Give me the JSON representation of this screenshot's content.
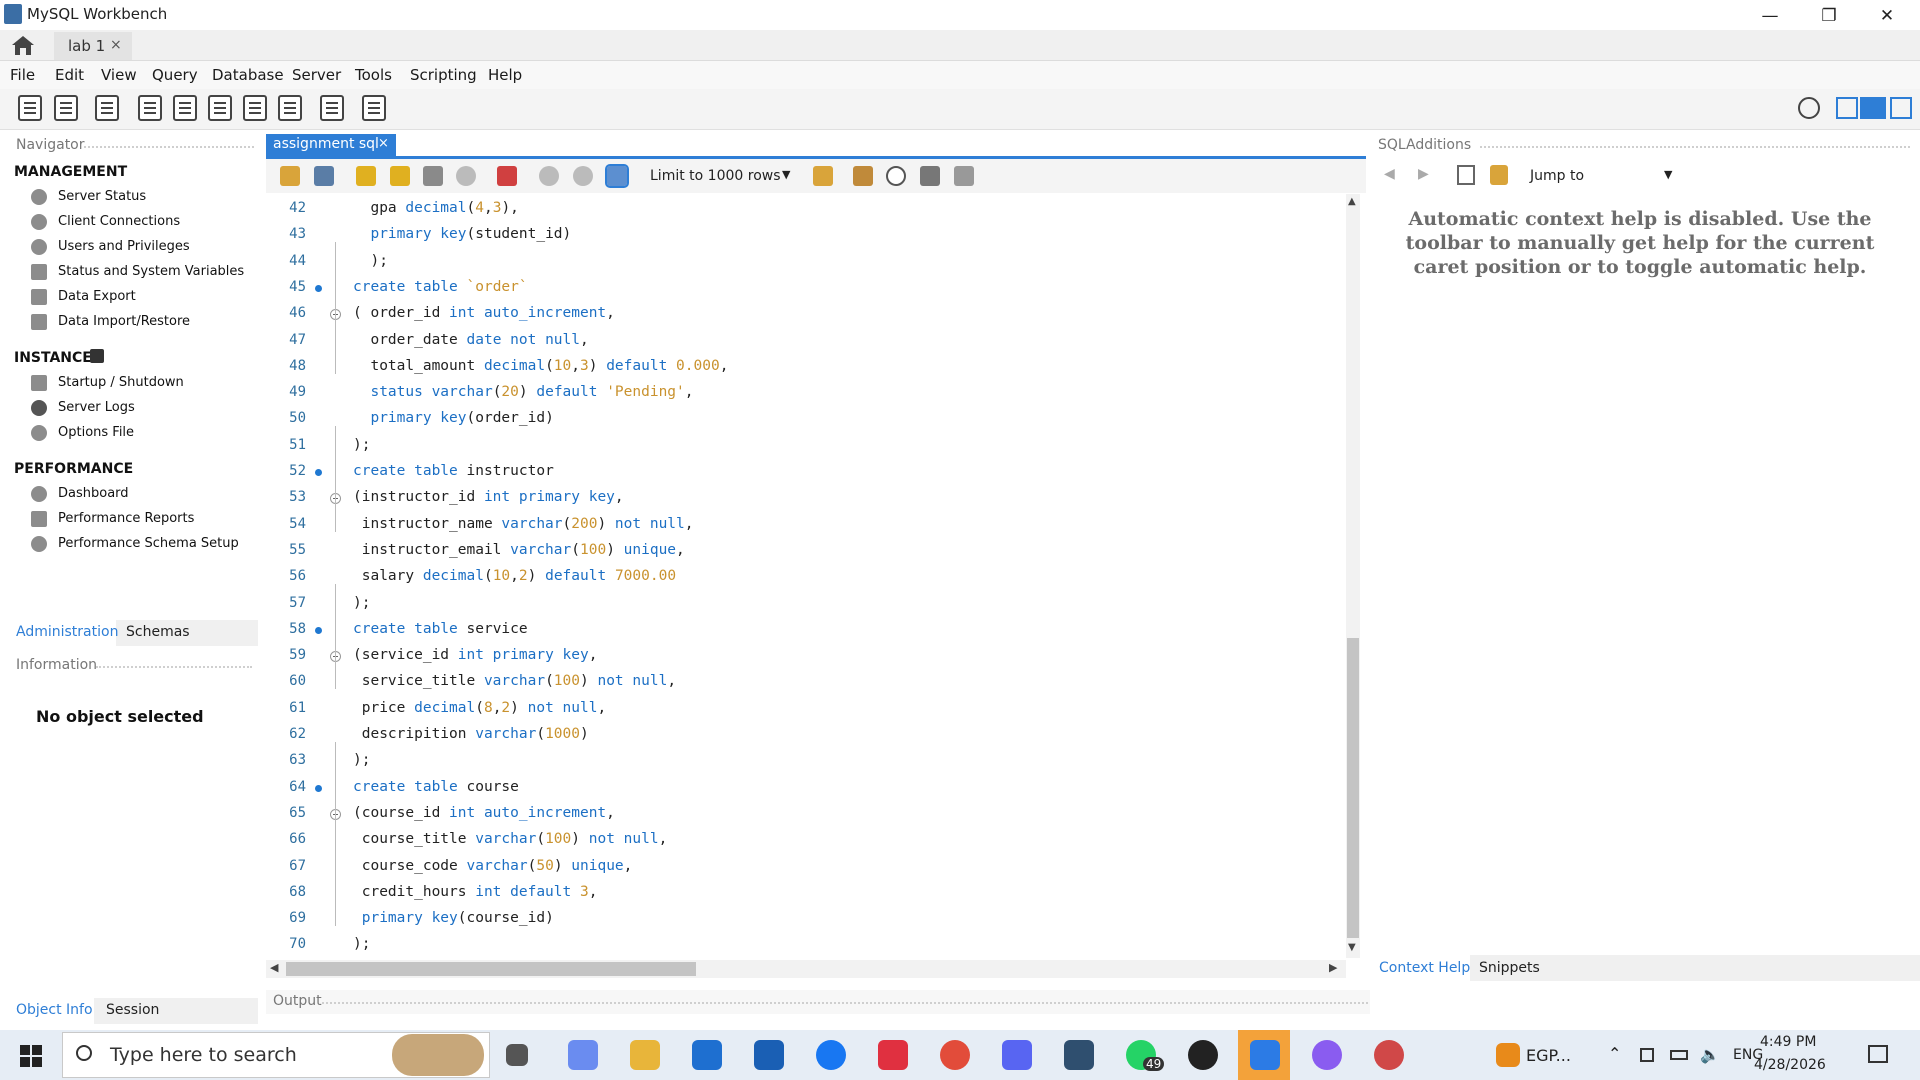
{
  "window": {
    "title": "MySQL Workbench",
    "minimize": "—",
    "maximize": "❐",
    "close": "✕"
  },
  "connection_tab": {
    "label": "lab 1",
    "close": "×"
  },
  "menu": [
    "File",
    "Edit",
    "View",
    "Query",
    "Database",
    "Server",
    "Tools",
    "Scripting",
    "Help"
  ],
  "navigator": {
    "title": "Navigator",
    "management": {
      "heading": "MANAGEMENT",
      "items": [
        "Server Status",
        "Client Connections",
        "Users and Privileges",
        "Status and System Variables",
        "Data Export",
        "Data Import/Restore"
      ]
    },
    "instance": {
      "heading": "INSTANCE",
      "items": [
        "Startup / Shutdown",
        "Server Logs",
        "Options File"
      ]
    },
    "performance": {
      "heading": "PERFORMANCE",
      "items": [
        "Dashboard",
        "Performance Reports",
        "Performance Schema Setup"
      ]
    },
    "tabs": [
      "Administration",
      "Schemas"
    ],
    "information": {
      "title": "Information",
      "message": "No object selected"
    },
    "bottom_tabs": [
      "Object Info",
      "Session"
    ]
  },
  "editor": {
    "tab_label": "assignment sql",
    "tab_close": "×",
    "limit_label": "Limit to 1000 rows",
    "lines": [
      {
        "n": "42",
        "code": [
          [
            "  gpa ",
            ""
          ],
          [
            "decimal",
            "t"
          ],
          [
            "(",
            ""
          ],
          [
            "4",
            "n"
          ],
          [
            ",",
            ""
          ],
          [
            "3",
            "n"
          ],
          [
            "),",
            ""
          ]
        ]
      },
      {
        "n": "43",
        "code": [
          [
            "  ",
            ""
          ],
          [
            "primary key",
            "k"
          ],
          [
            "(student_id)",
            ""
          ]
        ]
      },
      {
        "n": "44",
        "code": [
          [
            "  );",
            ""
          ]
        ]
      },
      {
        "n": "45",
        "code": [
          [
            "create table ",
            "k"
          ],
          [
            "`order`",
            "s"
          ]
        ]
      },
      {
        "n": "46",
        "code": [
          [
            "( order_id ",
            ""
          ],
          [
            "int auto_increment",
            "k"
          ],
          [
            ",",
            ""
          ]
        ]
      },
      {
        "n": "47",
        "code": [
          [
            "  order_date ",
            ""
          ],
          [
            "date not null",
            "k"
          ],
          [
            ",",
            ""
          ]
        ]
      },
      {
        "n": "48",
        "code": [
          [
            "  total_amount ",
            ""
          ],
          [
            "decimal",
            "t"
          ],
          [
            "(",
            ""
          ],
          [
            "10",
            "n"
          ],
          [
            ",",
            ""
          ],
          [
            "3",
            "n"
          ],
          [
            ") ",
            ""
          ],
          [
            "default ",
            "k"
          ],
          [
            "0.000",
            "n"
          ],
          [
            ",",
            ""
          ]
        ]
      },
      {
        "n": "49",
        "code": [
          [
            "  ",
            ""
          ],
          [
            "status varchar",
            "k"
          ],
          [
            "(",
            ""
          ],
          [
            "20",
            "n"
          ],
          [
            ") ",
            ""
          ],
          [
            "default ",
            "k"
          ],
          [
            "'Pending'",
            "s"
          ],
          [
            ",",
            ""
          ]
        ]
      },
      {
        "n": "50",
        "code": [
          [
            "  ",
            ""
          ],
          [
            "primary key",
            "k"
          ],
          [
            "(order_id)",
            ""
          ]
        ]
      },
      {
        "n": "51",
        "code": [
          [
            ");",
            ""
          ]
        ]
      },
      {
        "n": "52",
        "code": [
          [
            "create table ",
            "k"
          ],
          [
            "instructor",
            ""
          ]
        ]
      },
      {
        "n": "53",
        "code": [
          [
            "(instructor_id ",
            ""
          ],
          [
            "int primary key",
            "k"
          ],
          [
            ",",
            ""
          ]
        ]
      },
      {
        "n": "54",
        "code": [
          [
            " instructor_name ",
            ""
          ],
          [
            "varchar",
            "t"
          ],
          [
            "(",
            ""
          ],
          [
            "200",
            "n"
          ],
          [
            ") ",
            ""
          ],
          [
            "not null",
            "k"
          ],
          [
            ",",
            ""
          ]
        ]
      },
      {
        "n": "55",
        "code": [
          [
            " instructor_email ",
            ""
          ],
          [
            "varchar",
            "t"
          ],
          [
            "(",
            ""
          ],
          [
            "100",
            "n"
          ],
          [
            ") ",
            ""
          ],
          [
            "unique",
            "k"
          ],
          [
            ",",
            ""
          ]
        ]
      },
      {
        "n": "56",
        "code": [
          [
            " salary ",
            ""
          ],
          [
            "decimal",
            "t"
          ],
          [
            "(",
            ""
          ],
          [
            "10",
            "n"
          ],
          [
            ",",
            ""
          ],
          [
            "2",
            "n"
          ],
          [
            ") ",
            ""
          ],
          [
            "default ",
            "k"
          ],
          [
            "7000.00",
            "n"
          ]
        ]
      },
      {
        "n": "57",
        "code": [
          [
            ");",
            ""
          ]
        ]
      },
      {
        "n": "58",
        "code": [
          [
            "create table ",
            "k"
          ],
          [
            "service",
            ""
          ]
        ]
      },
      {
        "n": "59",
        "code": [
          [
            "(service_id ",
            ""
          ],
          [
            "int primary key",
            "k"
          ],
          [
            ",",
            ""
          ]
        ]
      },
      {
        "n": "60",
        "code": [
          [
            " service_title ",
            ""
          ],
          [
            "varchar",
            "t"
          ],
          [
            "(",
            ""
          ],
          [
            "100",
            "n"
          ],
          [
            ") ",
            ""
          ],
          [
            "not null",
            "k"
          ],
          [
            ",",
            ""
          ]
        ]
      },
      {
        "n": "61",
        "code": [
          [
            " price ",
            ""
          ],
          [
            "decimal",
            "t"
          ],
          [
            "(",
            ""
          ],
          [
            "8",
            "n"
          ],
          [
            ",",
            ""
          ],
          [
            "2",
            "n"
          ],
          [
            ") ",
            ""
          ],
          [
            "not null",
            "k"
          ],
          [
            ",",
            ""
          ]
        ]
      },
      {
        "n": "62",
        "code": [
          [
            " descripition ",
            ""
          ],
          [
            "varchar",
            "t"
          ],
          [
            "(",
            ""
          ],
          [
            "1000",
            "n"
          ],
          [
            ")",
            ""
          ]
        ]
      },
      {
        "n": "63",
        "code": [
          [
            ");",
            ""
          ]
        ]
      },
      {
        "n": "64",
        "code": [
          [
            "create table ",
            "k"
          ],
          [
            "course",
            ""
          ]
        ]
      },
      {
        "n": "65",
        "code": [
          [
            "(course_id ",
            ""
          ],
          [
            "int auto_increment",
            "k"
          ],
          [
            ",",
            ""
          ]
        ]
      },
      {
        "n": "66",
        "code": [
          [
            " course_title ",
            ""
          ],
          [
            "varchar",
            "t"
          ],
          [
            "(",
            ""
          ],
          [
            "100",
            "n"
          ],
          [
            ") ",
            ""
          ],
          [
            "not null",
            "k"
          ],
          [
            ",",
            ""
          ]
        ]
      },
      {
        "n": "67",
        "code": [
          [
            " course_code ",
            ""
          ],
          [
            "varchar",
            "t"
          ],
          [
            "(",
            ""
          ],
          [
            "50",
            "n"
          ],
          [
            ") ",
            ""
          ],
          [
            "unique",
            "k"
          ],
          [
            ",",
            ""
          ]
        ]
      },
      {
        "n": "68",
        "code": [
          [
            " credit_hours ",
            ""
          ],
          [
            "int default ",
            "k"
          ],
          [
            "3",
            "n"
          ],
          [
            ",",
            ""
          ]
        ]
      },
      {
        "n": "69",
        "code": [
          [
            " ",
            ""
          ],
          [
            "primary key",
            "k"
          ],
          [
            "(course_id)",
            ""
          ]
        ]
      },
      {
        "n": "70",
        "code": [
          [
            ");",
            ""
          ]
        ]
      }
    ]
  },
  "output": {
    "title": "Output"
  },
  "sql_additions": {
    "title": "SQLAdditions",
    "jump_label": "Jump to",
    "help_text": "Automatic context help is disabled. Use the toolbar to manually get help for the current caret position or to toggle automatic help.",
    "tabs": [
      "Context Help",
      "Snippets"
    ]
  },
  "taskbar": {
    "search_placeholder": "Type here to search",
    "whatsapp_badge": "49",
    "tray_app": "EGP...",
    "lang": "ENG",
    "time": "4:49 PM",
    "date": "4/28/2026"
  },
  "colors": {
    "accent": "#2e7ed6",
    "keyword": "#1c6fc4",
    "number": "#c9922e",
    "line_number": "#2f6f9f"
  }
}
